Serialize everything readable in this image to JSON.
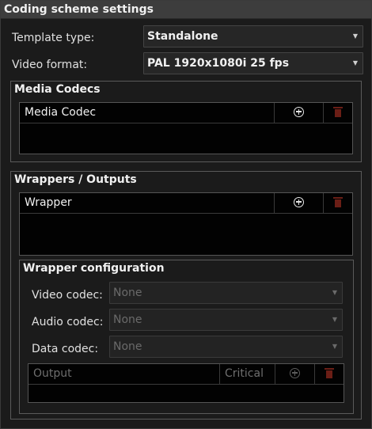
{
  "window": {
    "title": "Coding scheme settings"
  },
  "template_type": {
    "label": "Template type:",
    "value": "Standalone"
  },
  "video_format": {
    "label": "Video format:",
    "value": "PAL 1920x1080i 25 fps"
  },
  "media_codecs": {
    "title": "Media Codecs",
    "column_header": "Media Codec",
    "add_icon": "plus-circle-icon",
    "delete_icon": "trash-icon"
  },
  "wrappers": {
    "title": "Wrappers / Outputs",
    "column_header": "Wrapper",
    "add_icon": "plus-circle-icon",
    "delete_icon": "trash-icon"
  },
  "wrapper_config": {
    "title": "Wrapper configuration",
    "video_codec": {
      "label": "Video codec:",
      "value": "None"
    },
    "audio_codec": {
      "label": "Audio codec:",
      "value": "None"
    },
    "data_codec": {
      "label": "Data codec:",
      "value": "None"
    },
    "outputs_table": {
      "columns": [
        "Output",
        "Critical"
      ],
      "add_icon": "plus-circle-icon",
      "delete_icon": "trash-icon"
    }
  },
  "colors": {
    "title_bar": "#3d3d3d",
    "background": "#1b1b1b",
    "table_bg": "#020202",
    "delete_icon": "#6b1e16"
  }
}
